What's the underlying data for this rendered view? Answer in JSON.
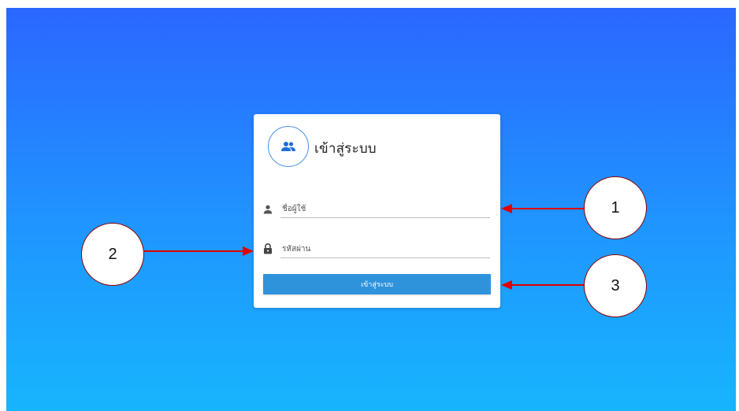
{
  "login": {
    "title": "เข้าสู่ระบบ",
    "avatar_icon": "users-group-icon",
    "username": {
      "icon": "user-icon",
      "placeholder": "ชื่อผู้ใช้",
      "value": ""
    },
    "password": {
      "icon": "lock-icon",
      "placeholder": "รหัสผ่าน",
      "value": ""
    },
    "submit_label": "เข้าสู่ระบบ"
  },
  "annotations": {
    "callout_1": "1",
    "callout_2": "2",
    "callout_3": "3"
  },
  "colors": {
    "background_top": "#2b67ff",
    "background_bottom": "#17b5fd",
    "button": "#2f93dc",
    "accent": "#4a90e2",
    "arrow": "#e00000"
  }
}
